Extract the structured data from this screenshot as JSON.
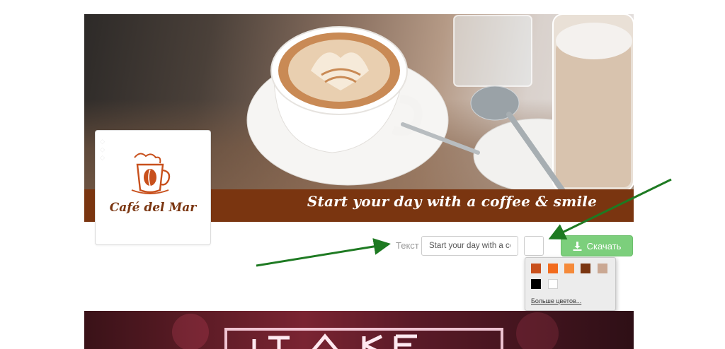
{
  "cover": {
    "slogan": "Start your day with a coffee & smile",
    "banner_color": "#7a3510"
  },
  "logo": {
    "name": "Café del Mar",
    "brand_color": "#7a3510"
  },
  "controls": {
    "text_label": "Текст",
    "text_input_value": "Start your day with a coffee & smile",
    "download_label": "Скачать",
    "download_icon": "download-icon",
    "download_color": "#7ccf7c"
  },
  "color_popup": {
    "swatches": [
      {
        "color": "#c8501c"
      },
      {
        "color": "#f26b1d"
      },
      {
        "color": "#f58a3a"
      },
      {
        "color": "#7a3510"
      },
      {
        "color": "#caa893"
      },
      {
        "color": "#000000"
      },
      {
        "color": "#ffffff"
      }
    ],
    "more_colors_label": "Больше цветов..."
  },
  "annotations": {
    "arrow_color": "#1e7a22"
  }
}
